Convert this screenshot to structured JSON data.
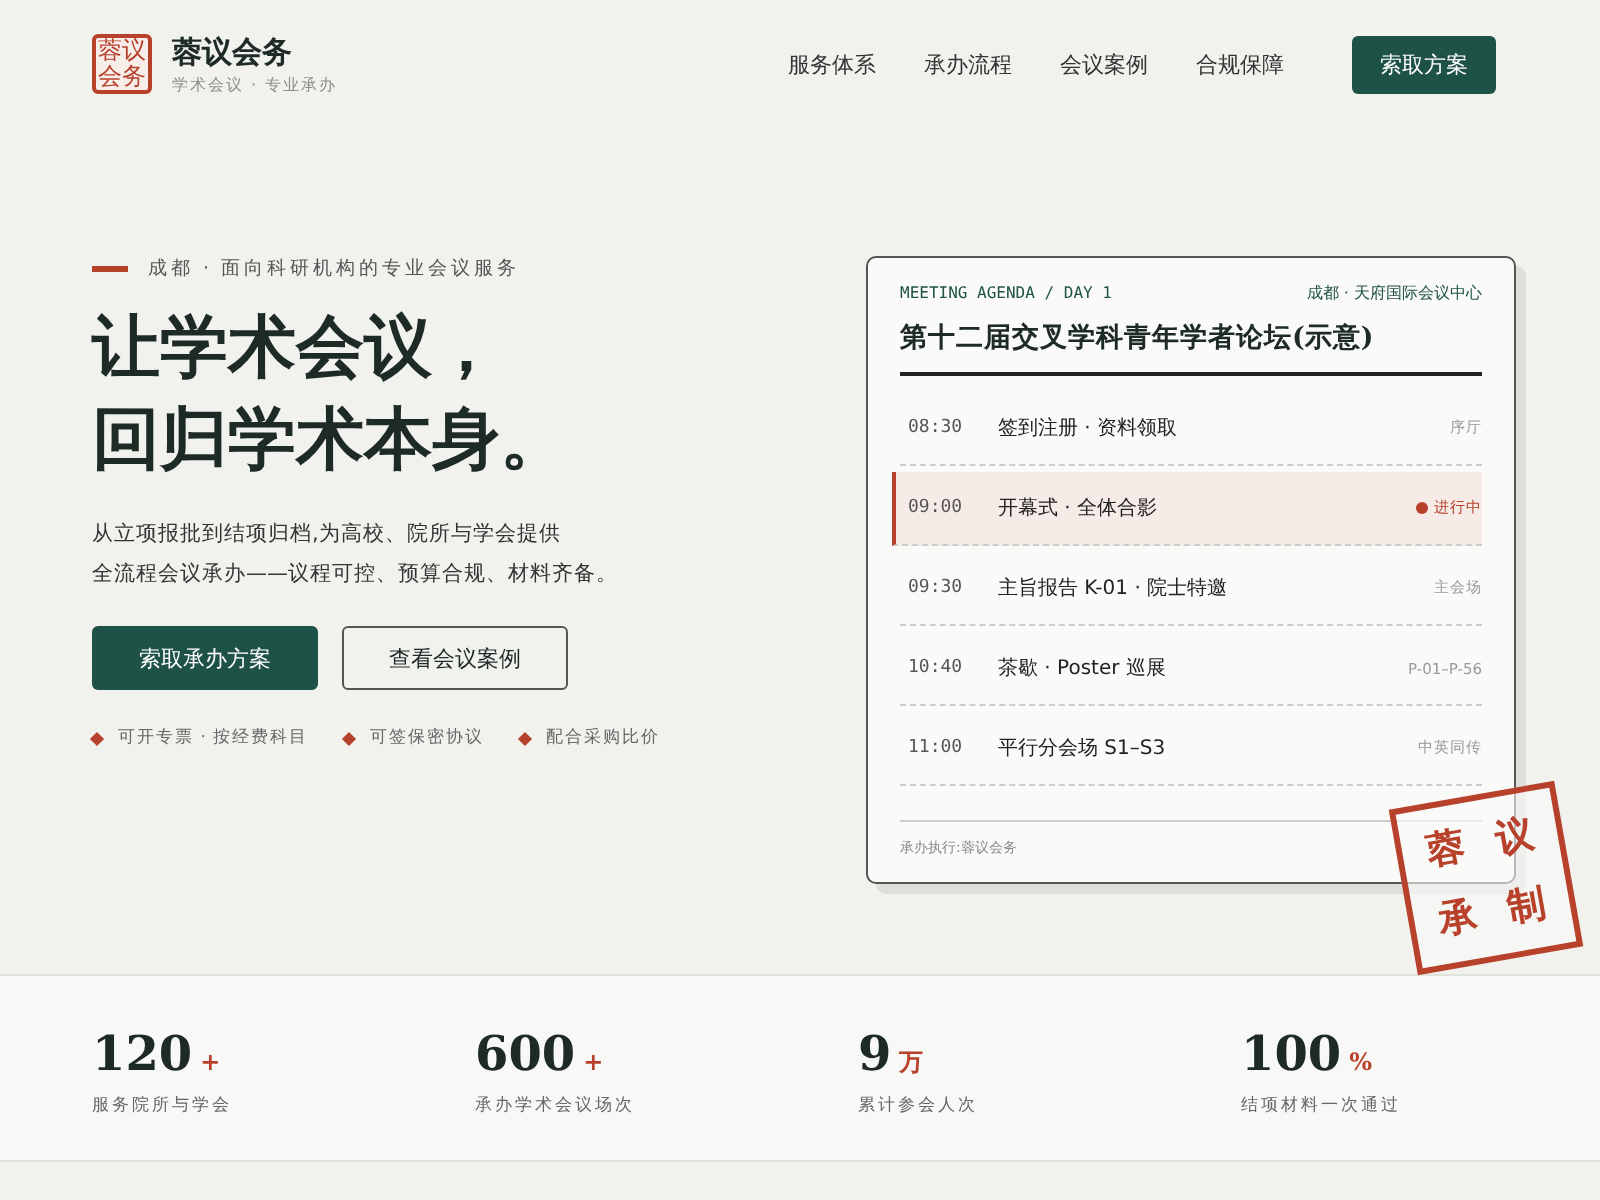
{
  "brand": {
    "logo": "蓉议会务",
    "name": "蓉议会务",
    "tagline": "学术会议 · 专业承办"
  },
  "nav": {
    "items": [
      "服务体系",
      "承办流程",
      "会议案例",
      "合规保障"
    ],
    "cta": "索取方案"
  },
  "hero": {
    "eyebrow": "成都 · 面向科研机构的专业会议服务",
    "title_lines": [
      "让学术会议，",
      "回归学术本身。"
    ],
    "description_lines": [
      "从立项报批到结项归档,为高校、院所与学会提供",
      "全流程会议承办——议程可控、预算合规、材料齐备。"
    ],
    "buttons": [
      {
        "label": "索取承办方案",
        "kind": "primary"
      },
      {
        "label": "查看会议案例",
        "kind": "outline"
      }
    ],
    "features": [
      "可开专票 · 按经费科目",
      "可签保密协议",
      "配合采购比价"
    ]
  },
  "agenda": {
    "label": "MEETING AGENDA / DAY 1",
    "venue": "成都 · 天府国际会议中心",
    "title": "第十二届交叉学科青年学者论坛(示意)",
    "rows": [
      {
        "time": "08:30",
        "event": "签到注册 · 资料领取",
        "note": "序厅",
        "selected": false
      },
      {
        "time": "09:00",
        "event": "开幕式 · 全体合影",
        "note": "进行中",
        "selected": true
      },
      {
        "time": "09:30",
        "event": "主旨报告 K-01 · 院士特邀",
        "note": "主会场",
        "selected": false
      },
      {
        "time": "10:40",
        "event": "茶歇 · Poster 巡展",
        "note": "P-01–P-56",
        "selected": false
      },
      {
        "time": "11:00",
        "event": "平行分会场 S1–S3",
        "note": "中英同传",
        "selected": false
      }
    ],
    "footer": "承办执行:蓉议会务",
    "stamp": [
      "蓉",
      "议",
      "承",
      "制"
    ]
  },
  "stats": [
    {
      "number": "120",
      "unit": "+",
      "label": "服务院所与学会"
    },
    {
      "number": "600",
      "unit": "+",
      "label": "承办学术会议场次"
    },
    {
      "number": "9",
      "unit": "万",
      "label": "累计参会人次"
    },
    {
      "number": "100",
      "unit": "%",
      "label": "结项材料一次通过"
    }
  ]
}
